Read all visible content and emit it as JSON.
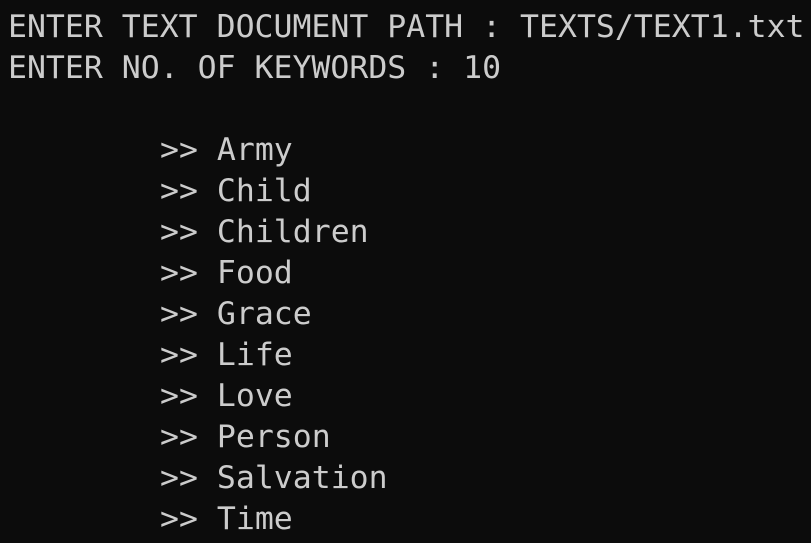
{
  "console": {
    "background": "#0c0c0c",
    "foreground": "#cccccc",
    "prompt_path": "ENTER TEXT DOCUMENT PATH : TEXTS/TEXT1.txt",
    "prompt_count": "ENTER NO. OF KEYWORDS : 10",
    "marker": ">>",
    "keywords": [
      "Army",
      "Child",
      "Children",
      "Food",
      "Grace",
      "Life",
      "Love",
      "Person",
      "Salvation",
      "Time"
    ]
  }
}
